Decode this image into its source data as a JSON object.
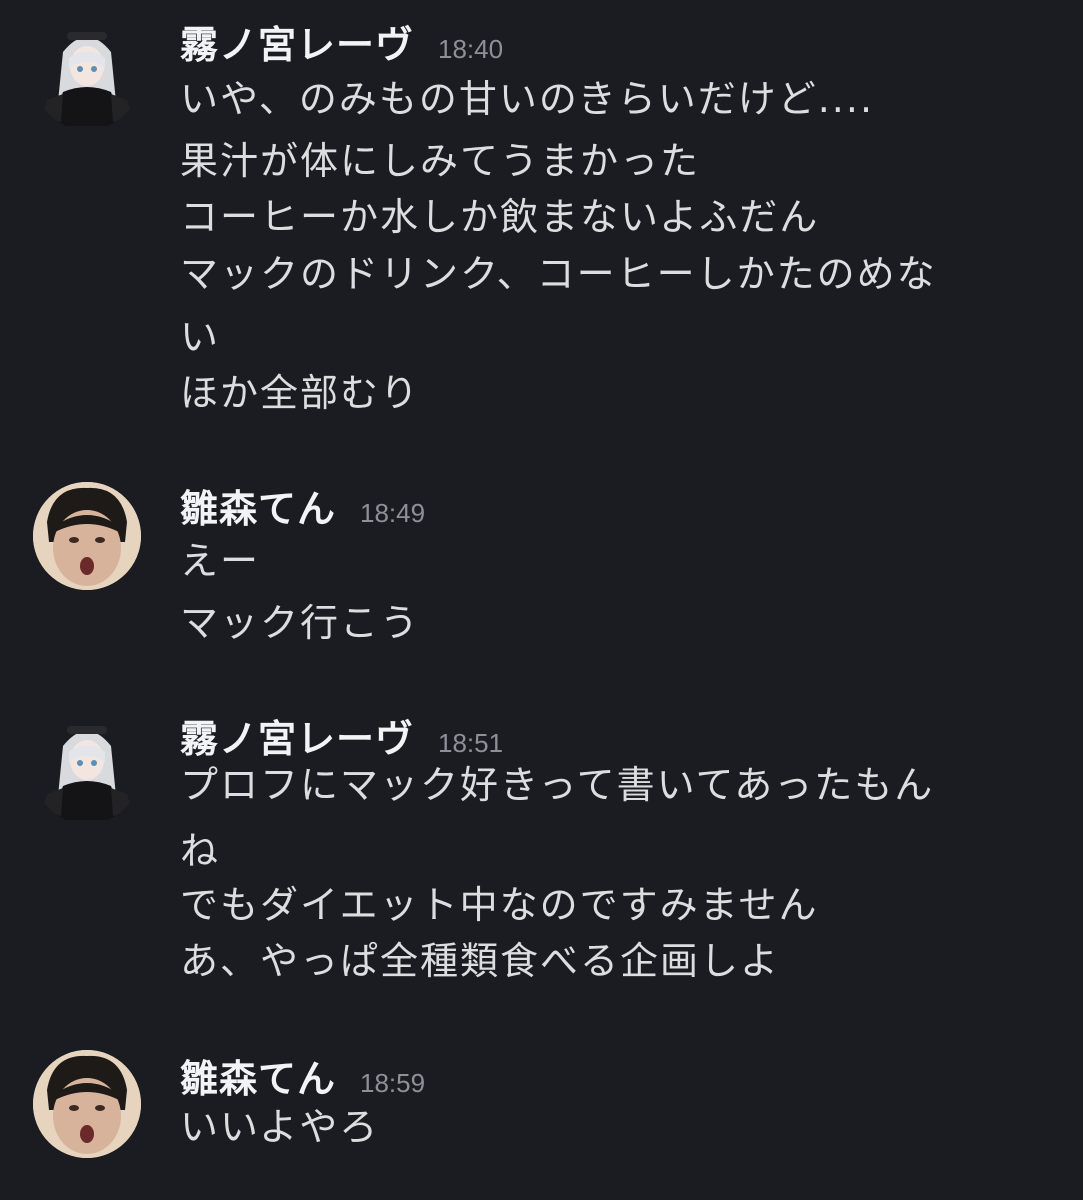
{
  "messages": [
    {
      "username": "霧ノ宮レーヴ",
      "time": "18:40",
      "avatar": "anime-girl-avatar",
      "lines": [
        "いや、のみもの甘いのきらいだけど....",
        "果汁が体にしみてうまかった",
        "コーヒーか水しか飲まないよふだん",
        "マックのドリンク、コーヒーしかたのめな",
        "い",
        "ほか全部むり"
      ]
    },
    {
      "username": "雛森てん",
      "time": "18:49",
      "avatar": "photo-avatar",
      "lines": [
        "えー",
        "マック行こう"
      ]
    },
    {
      "username": "霧ノ宮レーヴ",
      "time": "18:51",
      "avatar": "anime-girl-avatar",
      "lines": [
        "プロフにマック好きって書いてあったもん",
        "ね",
        "でもダイエット中なのですみません",
        "あ、やっぱ全種類食べる企画しよ"
      ]
    },
    {
      "username": "雛森てん",
      "time": "18:59",
      "avatar": "photo-avatar",
      "lines": [
        "いいよやろ"
      ]
    }
  ],
  "colors": {
    "background": "#1b1c21",
    "username": "#f2f3f5",
    "text": "#dcdde0",
    "timestamp": "#8e9098"
  }
}
